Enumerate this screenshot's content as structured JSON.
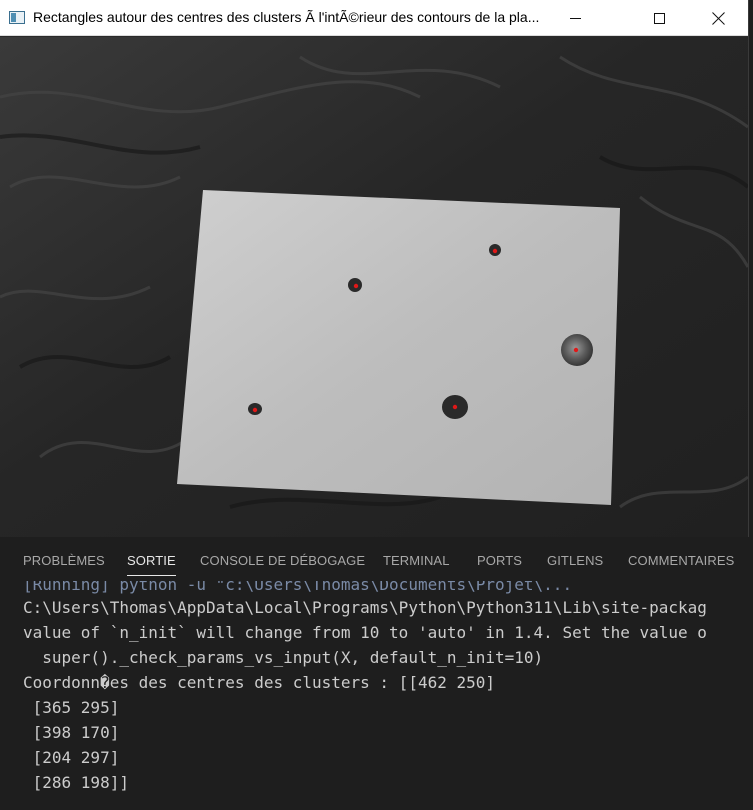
{
  "window": {
    "title": "Rectangles autour des centres des clusters Ã  l'intÃ©rieur des contours de la pla...",
    "icon": "opencv-window-icon"
  },
  "image": {
    "description_icon": "grayscale-photo",
    "colors": {
      "background_cloth": "#2b2b2b",
      "sheet": "#bdbdbd",
      "blob": "#2a2a2a",
      "marker": "#e01818"
    }
  },
  "panel": {
    "tabs": [
      {
        "label": "PROBLÈMES"
      },
      {
        "label": "SORTIE"
      },
      {
        "label": "CONSOLE DE DÉBOGAGE"
      },
      {
        "label": "TERMINAL"
      },
      {
        "label": "PORTS"
      },
      {
        "label": "GITLENS"
      },
      {
        "label": "COMMENTAIRES"
      }
    ],
    "active_tab": "SORTIE",
    "lines": [
      "[Running] python -u \"c:\\Users\\Thomas\\Documents\\Projet\\...",
      "C:\\Users\\Thomas\\AppData\\Local\\Programs\\Python\\Python311\\Lib\\site-packag",
      "value of `n_init` will change from 10 to 'auto' in 1.4. Set the value o",
      "  super()._check_params_vs_input(X, default_n_init=10)",
      "Coordonn�es des centres des clusters : [[462 250]",
      " [365 295]",
      " [398 170]",
      " [204 297]",
      " [286 198]]"
    ]
  }
}
